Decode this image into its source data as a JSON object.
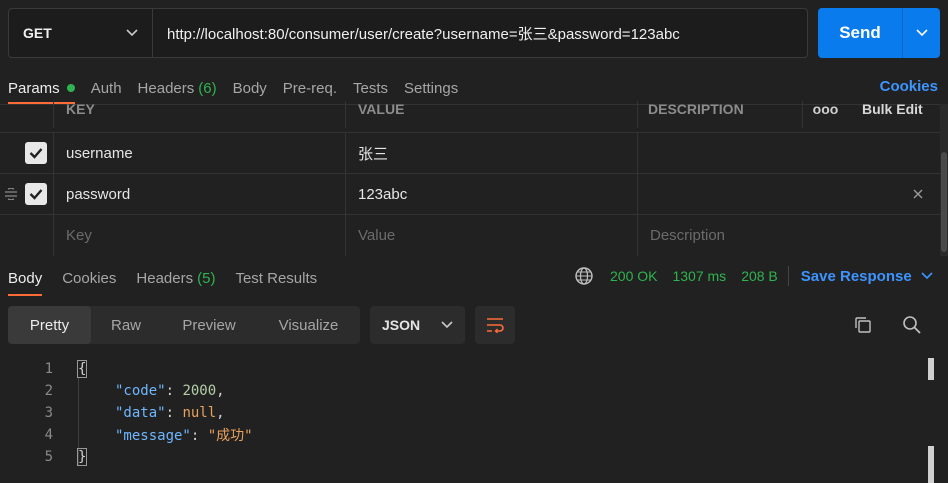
{
  "request": {
    "method": "GET",
    "url": "http://localhost:80/consumer/user/create?username=张三&password=123abc",
    "send_label": "Send"
  },
  "request_tabs": {
    "params": "Params",
    "auth": "Auth",
    "headers": "Headers",
    "headers_count": "(6)",
    "body": "Body",
    "prereq": "Pre-req.",
    "tests": "Tests",
    "settings": "Settings",
    "cookies": "Cookies"
  },
  "params_table": {
    "headers": {
      "key": "KEY",
      "value": "VALUE",
      "description": "DESCRIPTION",
      "more": "ooo",
      "bulk_edit": "Bulk Edit"
    },
    "rows": [
      {
        "checked": true,
        "key": "username",
        "value": "张三",
        "description": ""
      },
      {
        "checked": true,
        "key": "password",
        "value": "123abc",
        "description": ""
      }
    ],
    "placeholder": {
      "key": "Key",
      "value": "Value",
      "description": "Description"
    }
  },
  "response_tabs": {
    "body": "Body",
    "cookies": "Cookies",
    "headers": "Headers",
    "headers_count": "(5)",
    "test_results": "Test Results"
  },
  "response_status": {
    "status": "200 OK",
    "time": "1307 ms",
    "size": "208 B",
    "save_response": "Save Response"
  },
  "view_modes": {
    "pretty": "Pretty",
    "raw": "Raw",
    "preview": "Preview",
    "visualize": "Visualize",
    "format": "JSON"
  },
  "response_body": {
    "line_numbers": [
      "1",
      "2",
      "3",
      "4",
      "5"
    ],
    "open_brace": "{",
    "close_brace": "}",
    "code_key": "\"code\"",
    "code_value": "2000",
    "data_key": "\"data\"",
    "data_value": "null",
    "message_key": "\"message\"",
    "message_value": "\"成功\""
  },
  "colors": {
    "accent": "#ff6c37",
    "send": "#097bed",
    "success": "#2fb34e",
    "link": "#3d94ff"
  }
}
